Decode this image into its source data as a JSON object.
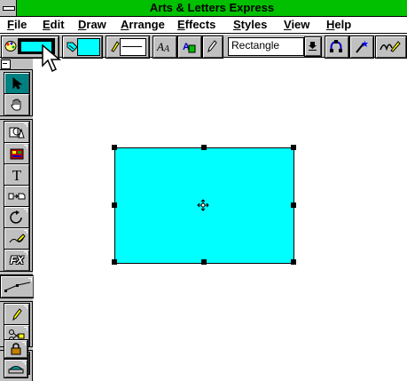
{
  "window": {
    "title": "Arts & Letters Express"
  },
  "menubar": {
    "items": [
      {
        "label": "File",
        "key": "F",
        "rest": "ile"
      },
      {
        "label": "Edit",
        "key": "E",
        "rest": "dit"
      },
      {
        "label": "Draw",
        "key": "D",
        "rest": "raw"
      },
      {
        "label": "Arrange",
        "key": "A",
        "rest": "rrange"
      },
      {
        "label": "Effects",
        "key": "E",
        "rest": "ffects"
      },
      {
        "label": "Styles",
        "key": "S",
        "rest": "tyles"
      },
      {
        "label": "View",
        "key": "V",
        "rest": "iew"
      },
      {
        "label": "Help",
        "key": "H",
        "rest": "elp"
      }
    ]
  },
  "ribbon": {
    "fill_color": "#00ffff",
    "line_color": "#00ffff",
    "object_type": "Rectangle",
    "icons": [
      "palette-icon",
      "fill-icon",
      "line-style-icon",
      "type-style-icon",
      "text-color-icon",
      "pen-icon",
      "dropdown-arrow-icon",
      "nodes-icon",
      "magic-wand-icon",
      "signature-icon"
    ]
  },
  "toolbox": {
    "tools": [
      "select-arrow",
      "hand",
      "shapes",
      "clipart",
      "text",
      "convert",
      "rotate",
      "freehand",
      "effects",
      "measure",
      "pen",
      "scissors",
      "zoom",
      "lock",
      "fill-bucket"
    ],
    "text_tool_glyph": "T",
    "fx_tool_glyph": "FX"
  },
  "canvas": {
    "shape": {
      "type": "Rectangle",
      "fill": "#00ffff",
      "stroke": "#000000"
    }
  },
  "colors": {
    "titlebar": "#00c000",
    "chrome": "#c0c0c0",
    "selected_tool": "#008080",
    "accent": "#00ffff"
  }
}
